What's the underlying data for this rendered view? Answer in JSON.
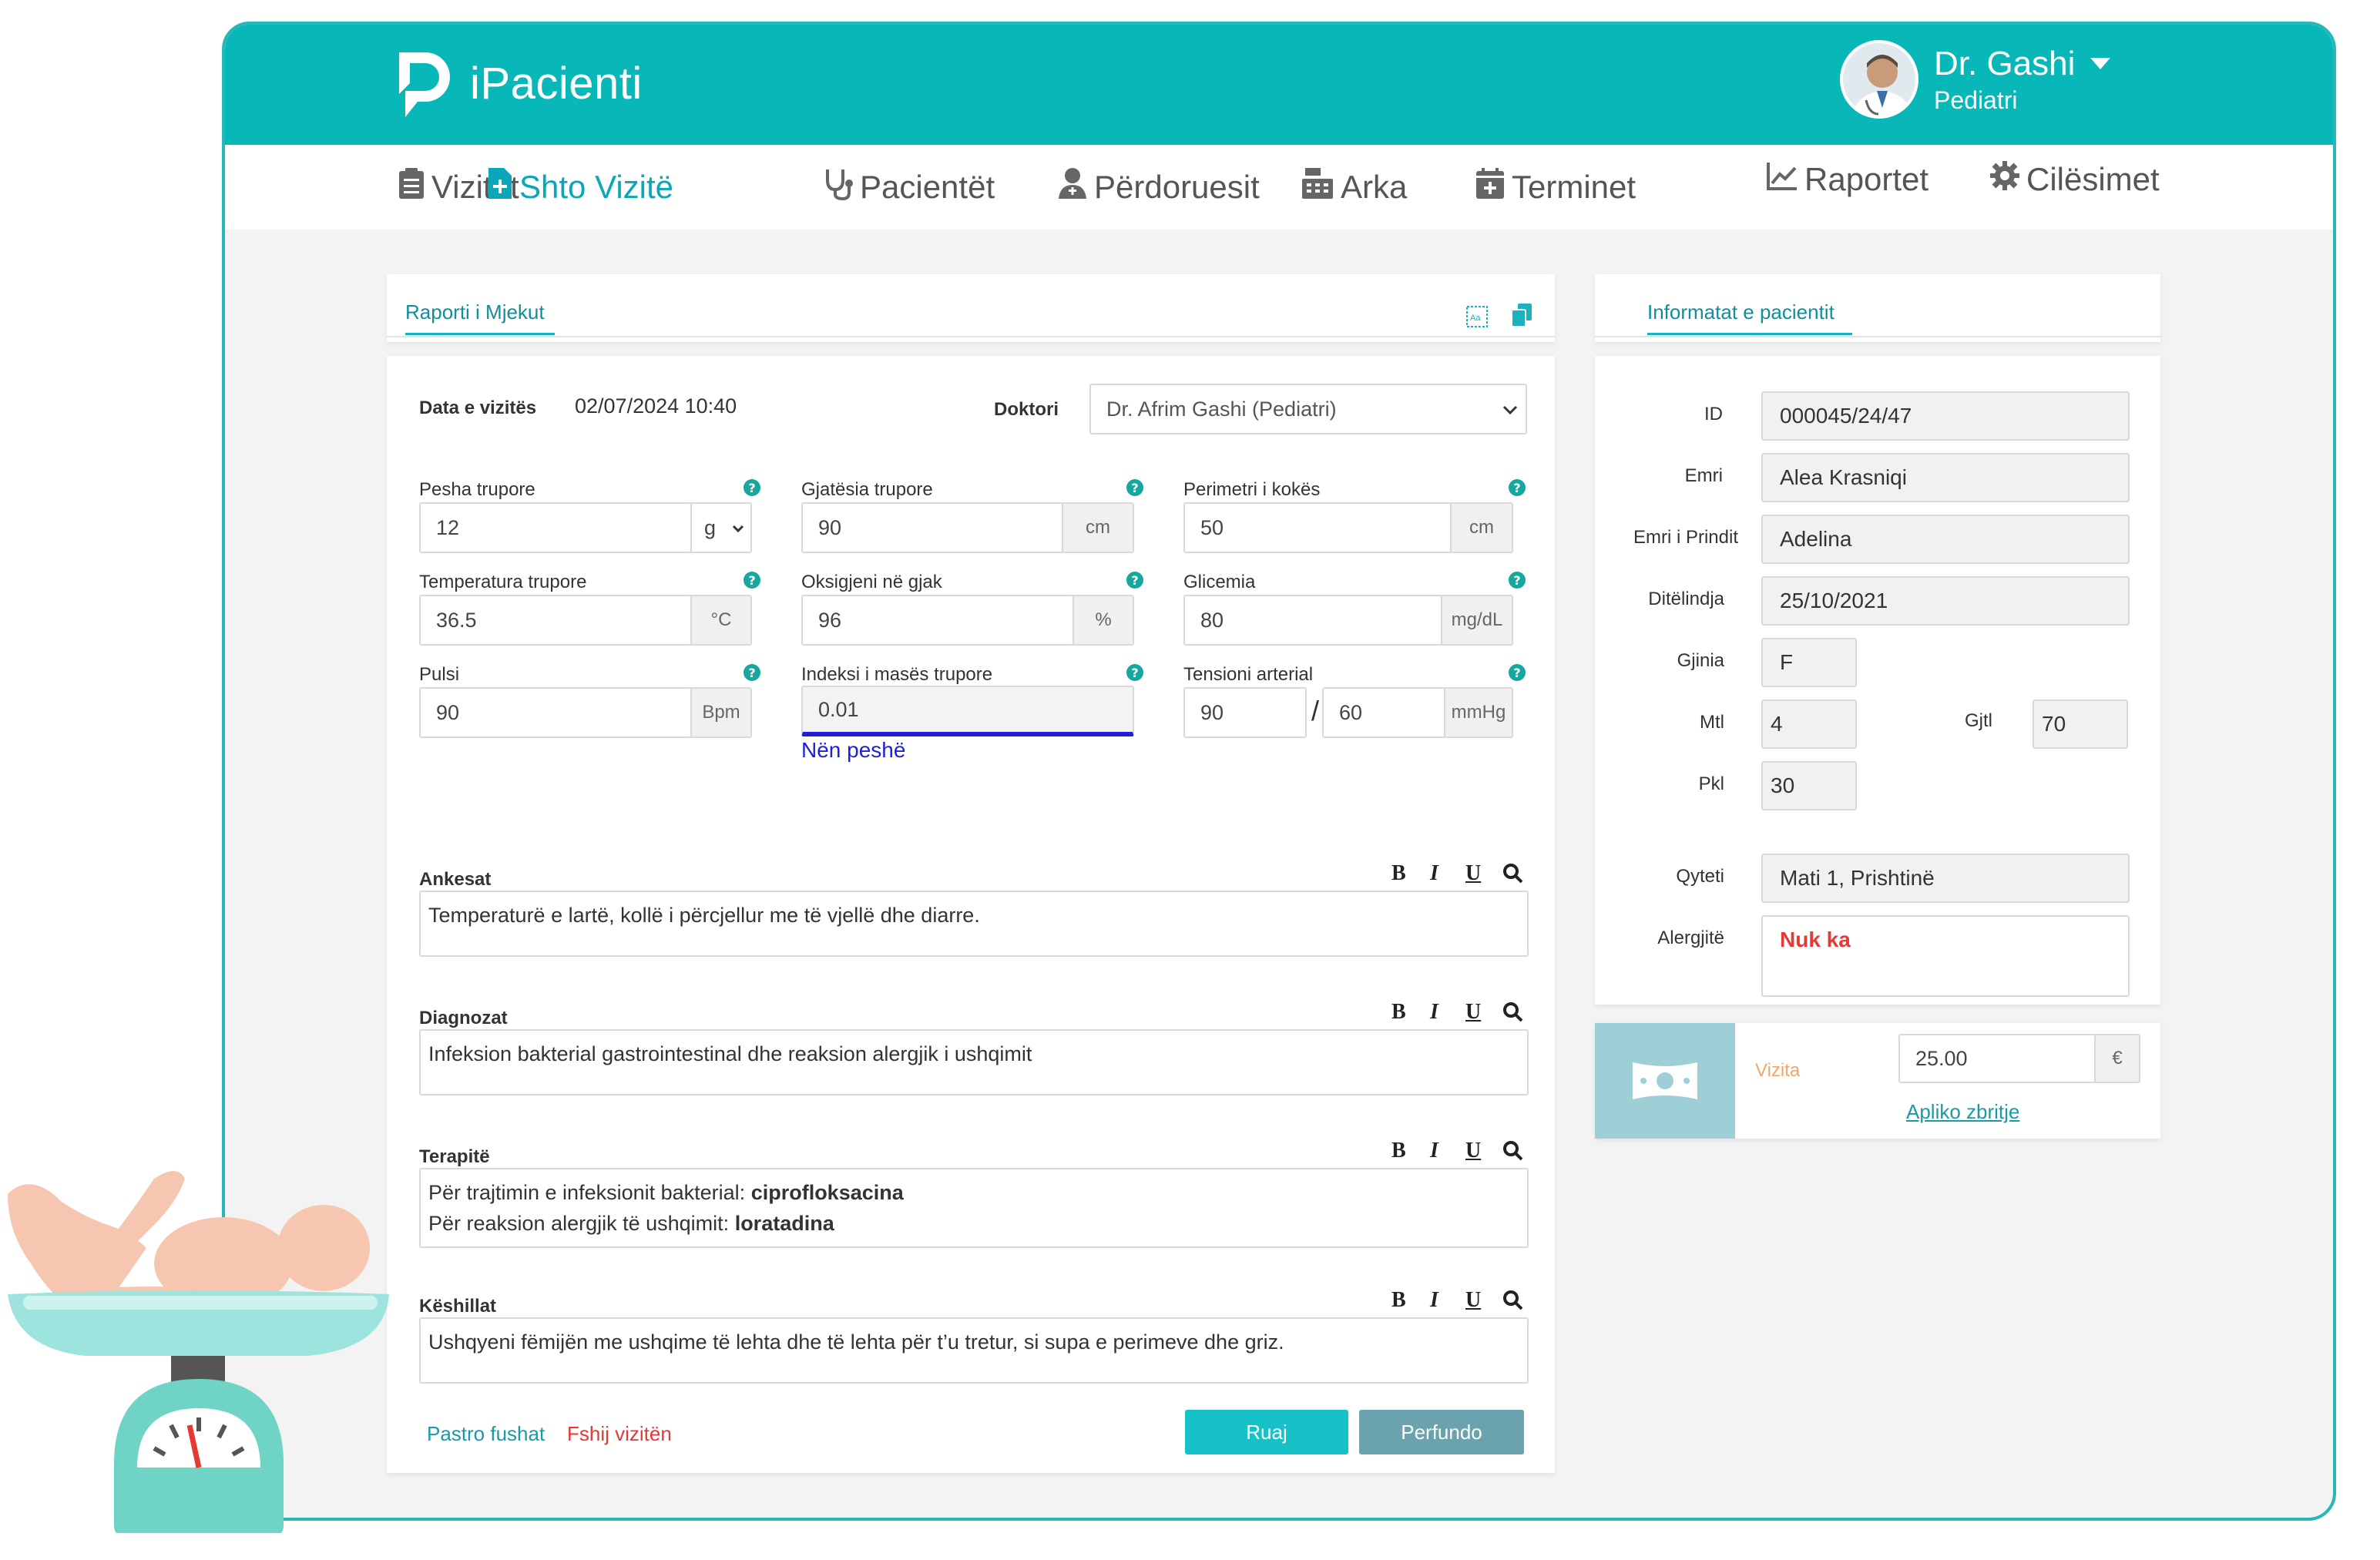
{
  "app": {
    "brand": "iPacienti"
  },
  "user": {
    "name": "Dr. Gashi",
    "role": "Pediatri"
  },
  "nav": [
    {
      "label": "Vizitat",
      "icon": "clipboard-icon"
    },
    {
      "label": "Shto Vizitë",
      "icon": "add-file-icon",
      "active": true
    },
    {
      "label": "Pacientët",
      "icon": "stethoscope-icon"
    },
    {
      "label": "Përdoruesit",
      "icon": "users-icon"
    },
    {
      "label": "Arka",
      "icon": "cash-register-icon"
    },
    {
      "label": "Terminet",
      "icon": "calendar-plus-icon"
    },
    {
      "label": "Raportet",
      "icon": "chart-line-icon"
    },
    {
      "label": "Cilësimet",
      "icon": "gear-icon"
    }
  ],
  "report": {
    "tab": "Raporti i Mjekut",
    "visit_date_label": "Data e vizitës",
    "visit_date": "02/07/2024 10:40",
    "doctor_label": "Doktori",
    "doctor_value": "Dr. Afrim Gashi (Pediatri)",
    "vitals": {
      "weight": {
        "label": "Pesha trupore",
        "value": "12",
        "unit": "g"
      },
      "height": {
        "label": "Gjatësia trupore",
        "value": "90",
        "unit": "cm"
      },
      "head": {
        "label": "Perimetri i kokës",
        "value": "50",
        "unit": "cm"
      },
      "temp": {
        "label": "Temperatura trupore",
        "value": "36.5",
        "unit": "°C"
      },
      "oxygen": {
        "label": "Oksigjeni në gjak",
        "value": "96",
        "unit": "%"
      },
      "glucose": {
        "label": "Glicemia",
        "value": "80",
        "unit": "mg/dL"
      },
      "pulse": {
        "label": "Pulsi",
        "value": "90",
        "unit": "Bpm"
      },
      "bmi": {
        "label": "Indeksi i masës trupore",
        "value": "0.01",
        "note": "Nën peshë"
      },
      "bp": {
        "label": "Tensioni arterial",
        "sys": "90",
        "sep": "/",
        "dia": "60",
        "unit": "mmHg"
      }
    },
    "format_buttons": {
      "bold": "B",
      "italic": "I",
      "underline": "U"
    },
    "sections": {
      "complaints": {
        "label": "Ankesat",
        "text": "Temperaturë e lartë, kollë i përcjellur me të vjellë dhe diarre."
      },
      "diagnoses": {
        "label": "Diagnozat",
        "text": "Infeksion bakterial gastrointestinal dhe reaksion alergjik i ushqimit"
      },
      "therapies": {
        "label": "Terapitë",
        "line1_prefix": "Për trajtimin e infeksionit bakterial:",
        "line1_drug": "ciprofloksacina",
        "line2_prefix": "Për reaksion alergjik të ushqimit:",
        "line2_drug": "loratadina"
      },
      "advice": {
        "label": "Këshillat",
        "text": "Ushqyeni fëmijën me ushqime të lehta dhe të lehta për t’u tretur, si supa e perimeve dhe griz."
      }
    },
    "actions": {
      "clear": "Pastro fushat",
      "delete": "Fshij vizitën",
      "save": "Ruaj",
      "finish": "Perfundo"
    }
  },
  "patient": {
    "tab": "Informatat e pacientit",
    "id_label": "ID",
    "id": "000045/24/47",
    "name_label": "Emri",
    "name": "Alea Krasniqi",
    "parent_label": "Emri i Prindit",
    "parent": "Adelina",
    "dob_label": "Ditëlindja",
    "dob": "25/10/2021",
    "gender_label": "Gjinia",
    "gender": "F",
    "mtl_label": "Mtl",
    "mtl": "4",
    "gjtl_label": "Gjtl",
    "gjtl": "70",
    "pkl_label": "Pkl",
    "pkl": "30",
    "city_label": "Qyteti",
    "city": "Mati 1, Prishtinë",
    "allergy_label": "Alergjitë",
    "allergy": "Nuk ka"
  },
  "payment": {
    "label": "Vizita",
    "amount": "25.00",
    "currency": "€",
    "discount_link": "Apliko zbritje"
  },
  "colors": {
    "primary": "#08b7b7",
    "save": "#17c1c8",
    "finish": "#6aa3ad",
    "danger": "#e53935",
    "bmi_link": "#1f1fd6",
    "payment_bg": "#9fcfd6"
  }
}
